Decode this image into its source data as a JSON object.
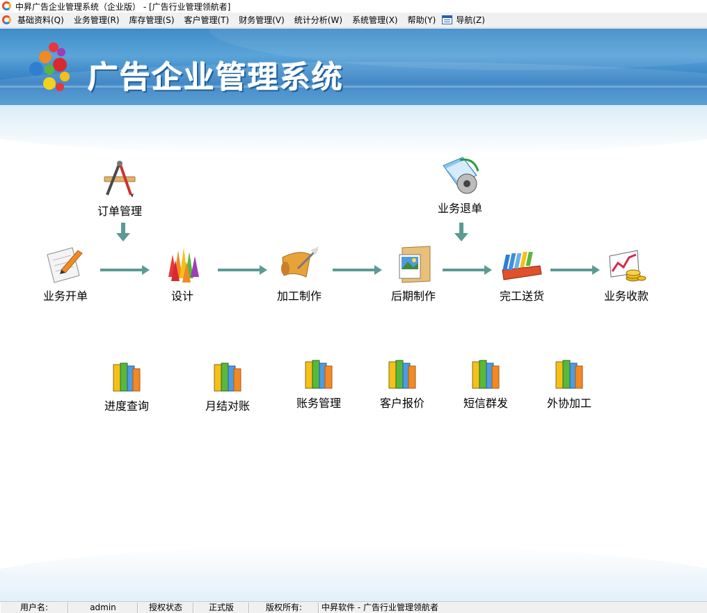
{
  "window": {
    "title": "中昇广告企业管理系统（企业版） - [广告行业管理领航者]"
  },
  "menubar": {
    "items": [
      {
        "label": "基础资料(Q)"
      },
      {
        "label": "业务管理(R)"
      },
      {
        "label": "库存管理(S)"
      },
      {
        "label": "客户管理(T)"
      },
      {
        "label": "财务管理(V)"
      },
      {
        "label": "统计分析(W)"
      },
      {
        "label": "系统管理(X)"
      },
      {
        "label": "帮助(Y)"
      },
      {
        "label": "导航(Z)",
        "icon": "navigator-window-icon"
      }
    ]
  },
  "banner": {
    "title": "广告企业管理系统",
    "logo": "colorful-dots-logo"
  },
  "flow": {
    "order_management": {
      "label": "订单管理",
      "icon": "drafting-tools-icon"
    },
    "business_refund": {
      "label": "业务退单",
      "icon": "folder-disc-icon"
    },
    "main": [
      {
        "label": "业务开单",
        "icon": "document-pen-icon"
      },
      {
        "label": "设计",
        "icon": "color-pencils-icon"
      },
      {
        "label": "加工制作",
        "icon": "scroll-quill-icon"
      },
      {
        "label": "后期制作",
        "icon": "photo-folder-icon"
      },
      {
        "label": "完工送货",
        "icon": "card-tray-icon"
      },
      {
        "label": "业务收款",
        "icon": "chart-coins-icon"
      }
    ]
  },
  "quick_links": [
    {
      "label": "进度查询",
      "icon": "books-icon"
    },
    {
      "label": "月结对账",
      "icon": "books-icon"
    },
    {
      "label": "账务管理",
      "icon": "books-icon"
    },
    {
      "label": "客户报价",
      "icon": "books-icon"
    },
    {
      "label": "短信群发",
      "icon": "books-icon"
    },
    {
      "label": "外协加工",
      "icon": "books-icon"
    }
  ],
  "statusbar": {
    "user_label": "用户名:",
    "user_value": "admin",
    "auth_label": "授权状态",
    "auth_value": "正式版",
    "copyright_label": "版权所有:",
    "copyright_value": "中昇软件 - 广告行业管理领航者"
  },
  "colors": {
    "banner_blue": "#3f8cc9",
    "arrow_teal": "#5b9b93"
  }
}
